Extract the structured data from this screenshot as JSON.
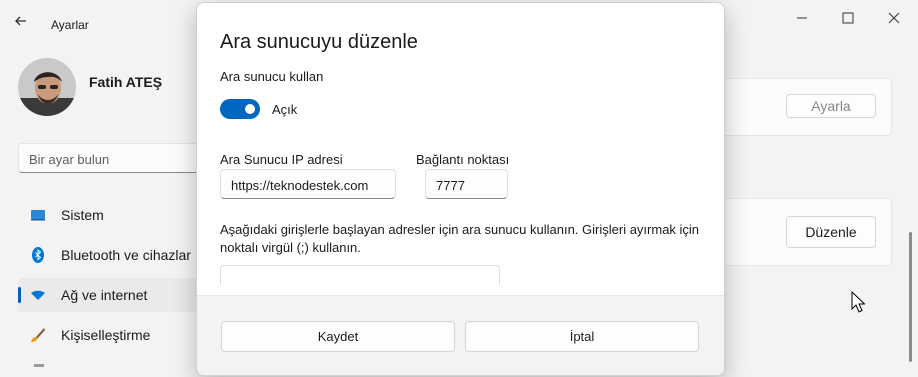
{
  "window": {
    "app_title": "Ayarlar"
  },
  "profile": {
    "name": "Fatih ATEŞ"
  },
  "search": {
    "placeholder": "Bir ayar bulun"
  },
  "sidebar": {
    "items": [
      {
        "label": "Sistem",
        "icon": "monitor-icon"
      },
      {
        "label": "Bluetooth ve cihazlar",
        "icon": "bluetooth-icon"
      },
      {
        "label": "Ağ ve internet",
        "icon": "wifi-icon",
        "active": true
      },
      {
        "label": "Kişiselleştirme",
        "icon": "brush-icon"
      }
    ]
  },
  "background": {
    "top_button_label": "Ayarla",
    "edit_button_label": "Düzenle"
  },
  "dialog": {
    "title": "Ara sunucuyu düzenle",
    "use_proxy_label": "Ara sunucu kullan",
    "toggle_state": "Açık",
    "ip_label": "Ara Sunucu IP adresi",
    "ip_value": "https://teknodestek.com",
    "port_label": "Bağlantı noktası",
    "port_value": "7777",
    "exceptions_desc": "Aşağıdaki girişlerle başlayan adresler için ara sunucu kullanın. Girişleri ayırmak için noktalı virgül (;) kullanın.",
    "save_label": "Kaydet",
    "cancel_label": "İptal"
  },
  "colors": {
    "accent": "#0067c0",
    "nav_indicator": "#005fb8"
  }
}
